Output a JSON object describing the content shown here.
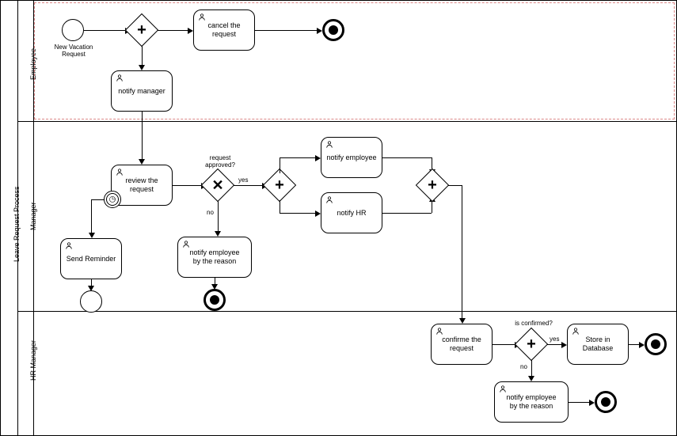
{
  "pool": {
    "title": "Leave Request Process"
  },
  "lanes": {
    "employee": "Employee",
    "manager": "Manager",
    "hr": "HR Manager"
  },
  "events": {
    "start": {
      "label": "New Vacation\nRequest"
    }
  },
  "tasks": {
    "cancel_request": "cancel the\nrequest",
    "notify_manager": "notify manager",
    "review_request": "review the\nrequest",
    "send_reminder": "Send Reminder",
    "notify_employee_reason_1": "notify employee\nby the reason",
    "notify_employee": "notify employee",
    "notify_hr": "notify HR",
    "confirm_request": "confirme the\nrequest",
    "store_db": "Store in\nDatabase",
    "notify_employee_reason_2": "notify employee\nby the reason"
  },
  "gateway_labels": {
    "request_approved": "request\napproved?",
    "is_confirmed": "is confirmed?"
  },
  "flow_labels": {
    "yes1": "yes",
    "no1": "no",
    "yes2": "yes",
    "no2": "no"
  },
  "chart_data": {
    "type": "bpmn",
    "pool": "Leave Request Process",
    "lanes": [
      "Employee",
      "Manager",
      "HR Manager"
    ],
    "nodes": [
      {
        "id": "start",
        "type": "startEvent",
        "lane": "Employee",
        "label": "New Vacation Request"
      },
      {
        "id": "gwCancel",
        "type": "parallelGateway",
        "lane": "Employee"
      },
      {
        "id": "cancel",
        "type": "userTask",
        "lane": "Employee",
        "label": "cancel the request"
      },
      {
        "id": "end1",
        "type": "terminateEndEvent",
        "lane": "Employee"
      },
      {
        "id": "notifyMgr",
        "type": "userTask",
        "lane": "Employee",
        "label": "notify manager"
      },
      {
        "id": "review",
        "type": "userTask",
        "lane": "Manager",
        "label": "review the request"
      },
      {
        "id": "timer",
        "type": "boundaryTimerEvent",
        "attachedTo": "review"
      },
      {
        "id": "remind",
        "type": "userTask",
        "lane": "Manager",
        "label": "Send Reminder"
      },
      {
        "id": "endRemind",
        "type": "endEvent",
        "lane": "Manager"
      },
      {
        "id": "gwApproved",
        "type": "exclusiveGateway",
        "lane": "Manager",
        "label": "request approved?"
      },
      {
        "id": "notifyReason1",
        "type": "userTask",
        "lane": "Manager",
        "label": "notify employee by the reason"
      },
      {
        "id": "endReject",
        "type": "terminateEndEvent",
        "lane": "Manager"
      },
      {
        "id": "gwSplit",
        "type": "parallelGateway",
        "lane": "Manager"
      },
      {
        "id": "notifyEmp",
        "type": "userTask",
        "lane": "Manager",
        "label": "notify employee"
      },
      {
        "id": "notifyHR",
        "type": "userTask",
        "lane": "Manager",
        "label": "notify HR"
      },
      {
        "id": "gwJoin",
        "type": "parallelGateway",
        "lane": "Manager"
      },
      {
        "id": "confirm",
        "type": "userTask",
        "lane": "HR Manager",
        "label": "confirme the request"
      },
      {
        "id": "gwConfirmed",
        "type": "parallelGateway",
        "lane": "HR Manager",
        "label": "is confirmed?"
      },
      {
        "id": "storeDB",
        "type": "userTask",
        "lane": "HR Manager",
        "label": "Store in Database"
      },
      {
        "id": "endStore",
        "type": "terminateEndEvent",
        "lane": "HR Manager"
      },
      {
        "id": "notifyReason2",
        "type": "userTask",
        "lane": "HR Manager",
        "label": "notify employee by the reason"
      },
      {
        "id": "endReason2",
        "type": "terminateEndEvent",
        "lane": "HR Manager"
      }
    ],
    "flows": [
      {
        "from": "start",
        "to": "gwCancel"
      },
      {
        "from": "gwCancel",
        "to": "cancel"
      },
      {
        "from": "cancel",
        "to": "end1"
      },
      {
        "from": "gwCancel",
        "to": "notifyMgr"
      },
      {
        "from": "notifyMgr",
        "to": "review"
      },
      {
        "from": "timer",
        "to": "remind"
      },
      {
        "from": "remind",
        "to": "endRemind"
      },
      {
        "from": "review",
        "to": "gwApproved"
      },
      {
        "from": "gwApproved",
        "to": "gwSplit",
        "label": "yes"
      },
      {
        "from": "gwApproved",
        "to": "notifyReason1",
        "label": "no"
      },
      {
        "from": "notifyReason1",
        "to": "endReject"
      },
      {
        "from": "gwSplit",
        "to": "notifyEmp"
      },
      {
        "from": "gwSplit",
        "to": "notifyHR"
      },
      {
        "from": "notifyEmp",
        "to": "gwJoin"
      },
      {
        "from": "notifyHR",
        "to": "gwJoin"
      },
      {
        "from": "gwJoin",
        "to": "confirm"
      },
      {
        "from": "confirm",
        "to": "gwConfirmed"
      },
      {
        "from": "gwConfirmed",
        "to": "storeDB",
        "label": "yes"
      },
      {
        "from": "storeDB",
        "to": "endStore"
      },
      {
        "from": "gwConfirmed",
        "to": "notifyReason2",
        "label": "no"
      },
      {
        "from": "notifyReason2",
        "to": "endReason2"
      }
    ]
  }
}
